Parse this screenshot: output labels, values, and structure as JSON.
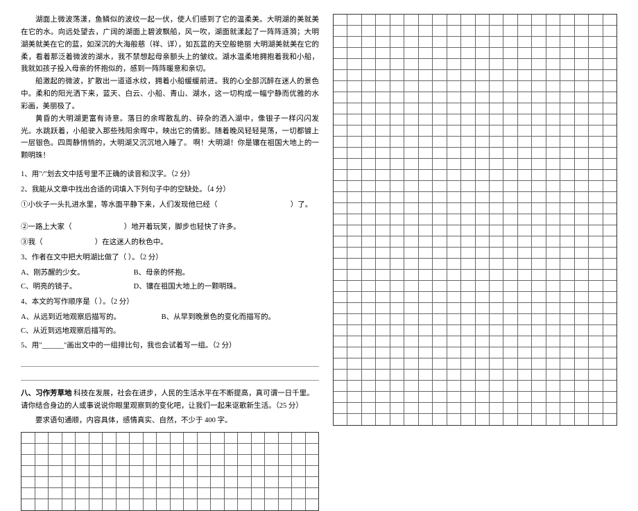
{
  "passage": {
    "p1": "湖面上微波荡漾，鱼鳞似的波纹一起一伏，使人们感到了它的温柔美。大明湖的美就美在它的水。向远处望去，广阔的湖面上碧波飘船，风一吹，湖面就漾起了一阵阵涟漪；大明湖美就美在它的蓝，如深沉的大海般慈（祥、详），如瓦蓝的天空般艳丽 大明湖美就美在它的柔，看着那泛着微波的湖水，我不禁想起母亲额头上的皱纹。湖水温柔地拥抱着我和小船，我就如孩子投入母亲的怀抱似的，感到一阵阵暖意和亲切。",
    "p2": "船激起的微波，扩散出一道道水纹，拥着小船缓缓前进。我的心全部沉醉在迷人的景色中。柔和的阳光洒下来，蓝天、白云、小船、青山、湖水，这一切构成一幅宁静而优雅的水彩画，美丽极了。",
    "p3": "黄昏的大明湖更富有诗意。落日的余晖散乱的、碎杂的洒入湖中，像银子一样闪闪发光。水跳跃着，小船驶入那些残阳余晖中，映出它的倩影。随着晚风轻轻晃荡，一切都镀上一层银色。四周静悄悄的，大明湖又沉沉地入睡了。        啊！大明湖！你是镶在祖国大地上的一颗明珠！"
  },
  "q1": "1、用\"/\"划去文中括号里不正确的读音和汉字。（2 分）",
  "q2": "2、我能从文章中找出合适的词填入下列句子中的空缺处。（4 分）",
  "q2_a_prefix": "①小伙子一头扎进水里，等水面平静下来，人们发现他已经（",
  "q2_a_suffix": "）了。",
  "q2_b_prefix": "②一路上大家（",
  "q2_b_suffix": "）地开着玩笑，脚步也轻快了许多。",
  "q2_c_prefix": "③我（",
  "q2_c_suffix": "）在这迷人的秋色中。",
  "q3": "3、作者在文中把大明湖比做了（              ）。（2 分）",
  "q3_opts": {
    "a": "A、刚苏醒的少女。",
    "b": "B、母亲的怀抱。",
    "c": "C、明亮的镜子。",
    "d": "D、镶在祖国大地上的一颗明珠。"
  },
  "q4": "4、本文的写作顺序是（          ）。（2 分）",
  "q4_opts": {
    "a": "A、从远到近地观察后描写的。",
    "b": "B、从早到晚景色的变化而描写的。",
    "c": "C、从近到远地观察后描写的。"
  },
  "q5": "5、用\"______\"画出文中的一组排比句，我也会试着写一组。（2 分）",
  "section8_label": "八、习作芳草地",
  "section8_text": "  科技在发展，社会在进步，人民的生活水平在不断提高，真可谓一日千里。请你结合身边的人或事说说你眼里观察到的变化吧，让我们一起来讴歌新生活。（25 分）",
  "section8_req": "要求语句通顺，内容具体，感情真实、自然，不少于 400 字。"
}
